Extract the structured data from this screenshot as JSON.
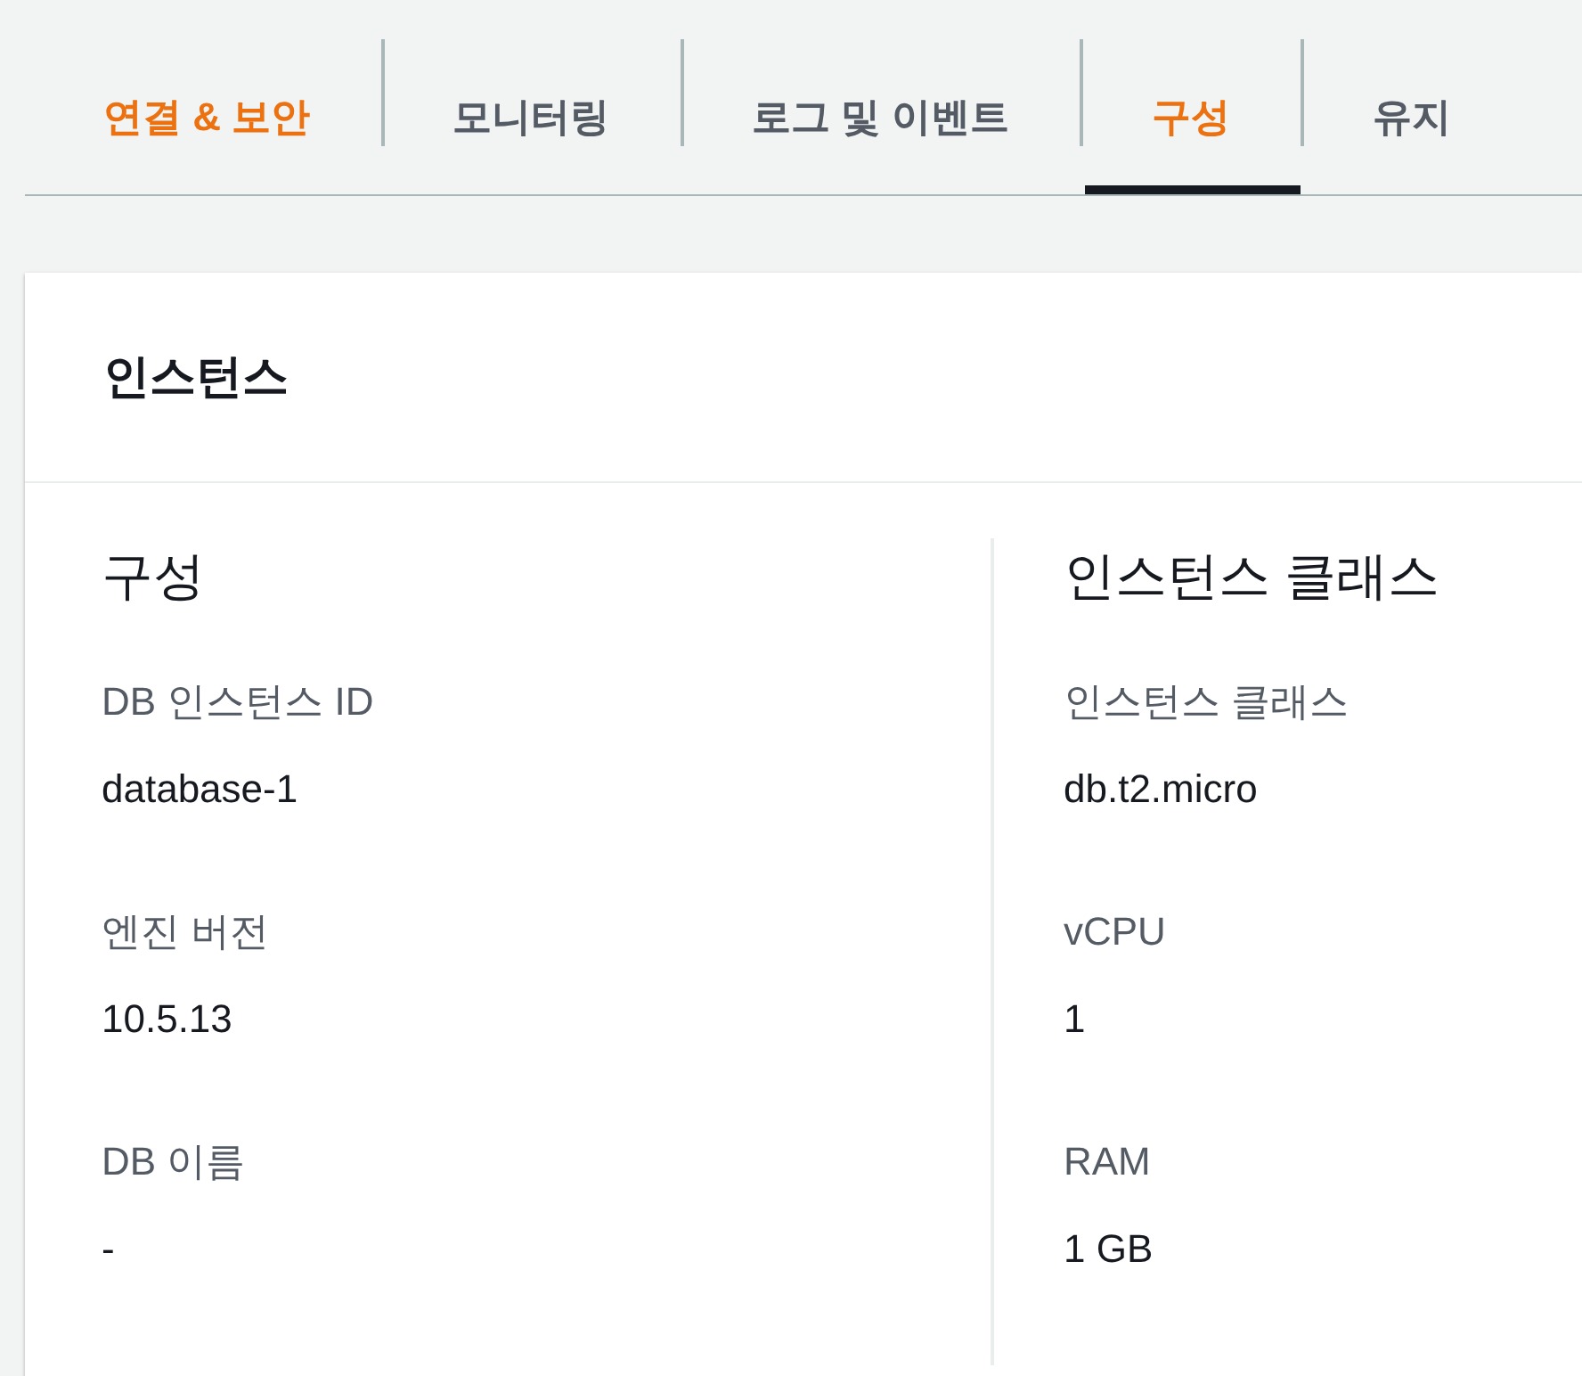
{
  "tabs": [
    {
      "label": "연결 & 보안",
      "selected": false,
      "hovered": true
    },
    {
      "label": "모니터링",
      "selected": false,
      "hovered": false
    },
    {
      "label": "로그 및 이벤트",
      "selected": false,
      "hovered": false
    },
    {
      "label": "구성",
      "selected": true,
      "hovered": false
    },
    {
      "label": "유지",
      "selected": false,
      "hovered": false
    }
  ],
  "panel": {
    "title": "인스턴스",
    "columns": [
      {
        "heading": "구성",
        "fields": [
          {
            "label": "DB 인스턴스 ID",
            "value": "database-1"
          },
          {
            "label": "엔진 버전",
            "value": "10.5.13"
          },
          {
            "label": "DB 이름",
            "value": "-"
          }
        ]
      },
      {
        "heading": "인스턴스 클래스",
        "fields": [
          {
            "label": "인스턴스 클래스",
            "value": "db.t2.micro"
          },
          {
            "label": "vCPU",
            "value": "1"
          },
          {
            "label": "RAM",
            "value": "1 GB"
          }
        ]
      }
    ]
  }
}
